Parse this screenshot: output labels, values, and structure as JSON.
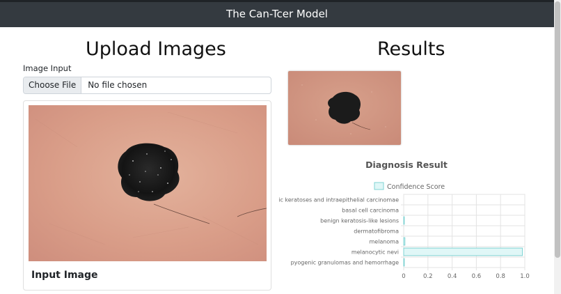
{
  "navbar": {
    "brand": "The Can-Tcer Model"
  },
  "upload": {
    "heading": "Upload Images",
    "input_label": "Image Input",
    "choose_button": "Choose File",
    "file_status": "No file chosen",
    "card_caption": "Input Image"
  },
  "results": {
    "heading": "Results"
  },
  "colors": {
    "navbar": "#343a40",
    "bar_fill": "#e0f7f7",
    "bar_stroke": "#7fd3d3",
    "skin": "#dca48e",
    "lesion": "#1a1a1a"
  },
  "icons": [
    "skin-lesion-image"
  ],
  "chart_data": {
    "type": "bar",
    "orientation": "horizontal",
    "title": "Diagnosis Result",
    "categories": [
      "Actinic keratoses and intraepithelial carcinomae",
      "basal cell carcinoma",
      "benign keratosis-like lesions",
      "dermatofibroma",
      "melanoma",
      "melanocytic nevi",
      "pyogenic granulomas and hemorrhage"
    ],
    "series": [
      {
        "name": "Confidence Score",
        "values": [
          0.0,
          0.0,
          0.005,
          0.0,
          0.01,
          0.98,
          0.005
        ]
      }
    ],
    "xlim": [
      0,
      1.0
    ],
    "xticks": [
      "0",
      "0.2",
      "0.4",
      "0.6",
      "0.8",
      "1.0"
    ],
    "legend": "top",
    "grid": true
  }
}
